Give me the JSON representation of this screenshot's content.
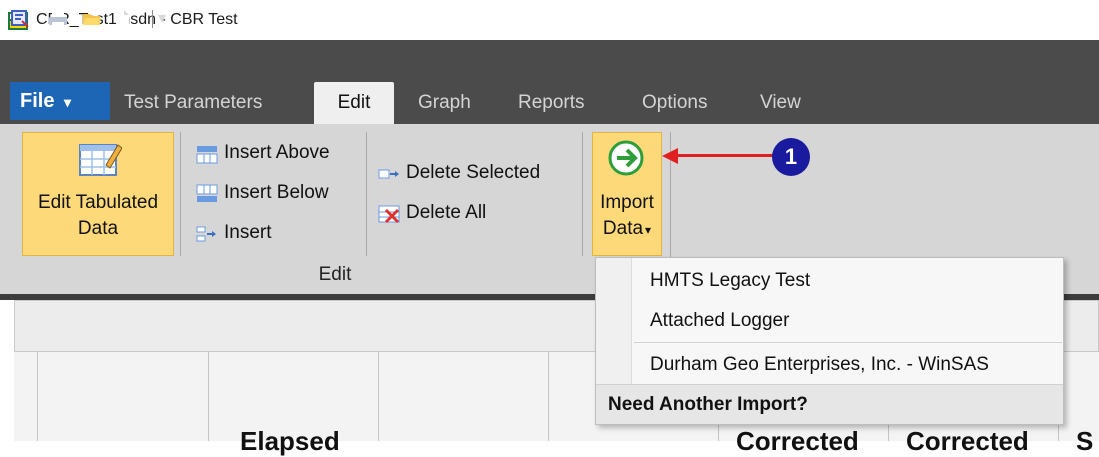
{
  "window": {
    "title": "CBR_Test1.hsdn - CBR Test"
  },
  "quick_access": {
    "items": [
      {
        "name": "properties-icon"
      },
      {
        "name": "print-icon"
      },
      {
        "name": "open-folder-icon"
      },
      {
        "name": "new-document-icon"
      }
    ],
    "customize_glyph": "▾"
  },
  "tabs": {
    "file": "File",
    "file_arrow": "▾",
    "items": [
      "Test Parameters",
      "Edit",
      "Graph",
      "Reports",
      "Options",
      "View"
    ],
    "active": "Edit"
  },
  "ribbon": {
    "edit_tabulated": {
      "line1": "Edit Tabulated",
      "line2": "Data"
    },
    "insert_above": "Insert Above",
    "insert_below": "Insert Below",
    "insert": "Insert",
    "delete_selected": "Delete Selected",
    "delete_all": "Delete All",
    "import": {
      "line1": "Import",
      "line2": "Data"
    },
    "group_label": "Edit"
  },
  "grid": {
    "col_headers": [
      "Elapsed",
      "Corrected",
      "Corrected",
      "S"
    ]
  },
  "dropdown": {
    "items": [
      "HMTS Legacy Test",
      "Attached Logger",
      "Durham Geo Enterprises, Inc. - WinSAS"
    ],
    "footer": "Need Another Import?"
  },
  "annotation": {
    "badge": "1"
  },
  "colors": {
    "file_tab": "#1d65b5",
    "highlight": "#fdd97a",
    "dark_chrome": "#4b4b4b",
    "callout_red": "#e02020",
    "badge_blue": "#1a1a9e"
  }
}
